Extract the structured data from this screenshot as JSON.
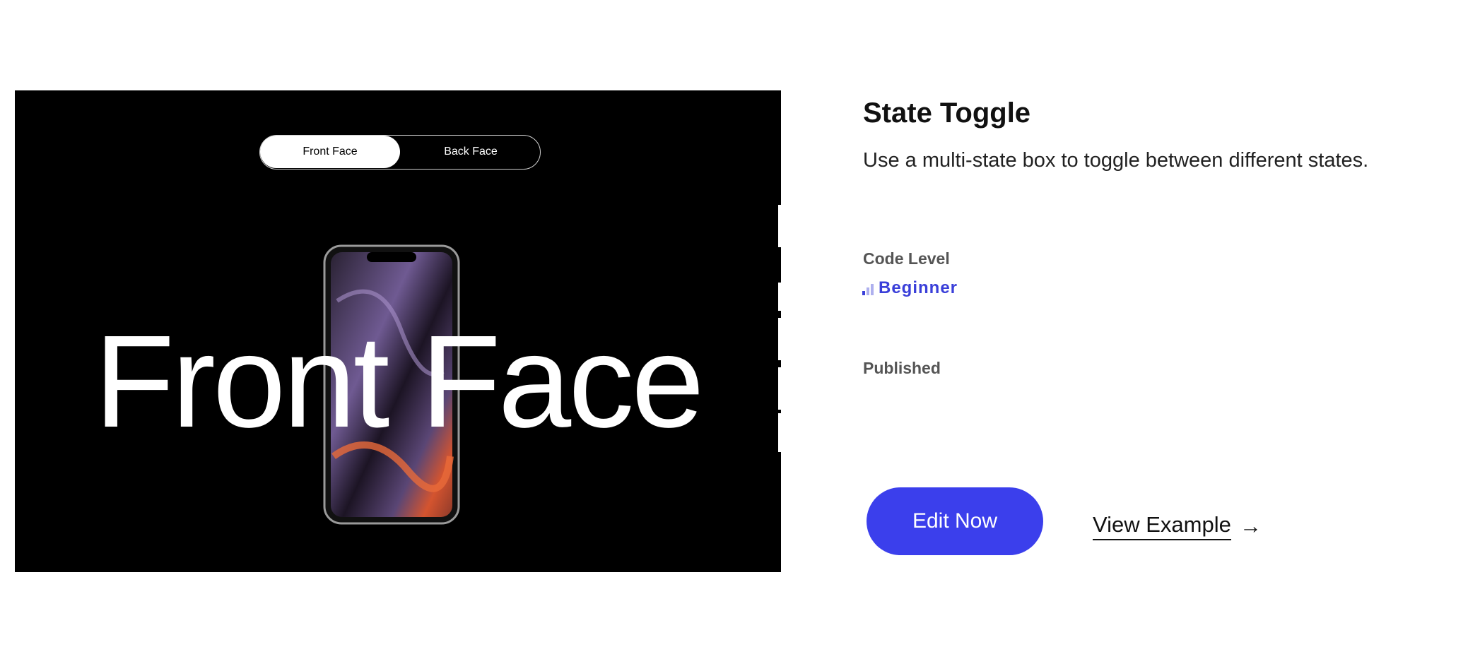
{
  "preview": {
    "toggle": {
      "front_label": "Front Face",
      "back_label": "Back Face"
    },
    "big_text": "Front Face"
  },
  "details": {
    "title": "State Toggle",
    "description": "Use a multi-state box to toggle between different states.",
    "code_level_label": "Code Level",
    "code_level_value": "Beginner",
    "published_label": "Published"
  },
  "actions": {
    "edit_label": "Edit Now",
    "view_label": "View Example",
    "view_arrow": "→"
  },
  "colors": {
    "accent": "#3b3fec",
    "level_text": "#3a3fd9"
  },
  "icons": [
    "signal-bars-icon",
    "arrow-right-icon"
  ]
}
